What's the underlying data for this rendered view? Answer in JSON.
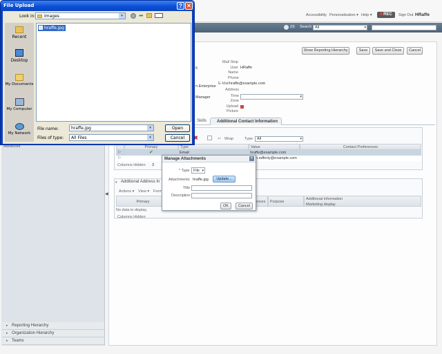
{
  "app": {
    "header_links": [
      "Accessibility",
      "Personalization ▾",
      "Help ▾"
    ],
    "brand": "REC",
    "sign_out": "Sign Out",
    "user": "HRaffe",
    "notif_count": "(0)",
    "search_label": "Search",
    "search_scope": "All"
  },
  "toolbar": {
    "show_hierarchy": "Show Reporting Hierarchy",
    "save": "Save",
    "save_close": "Save and Close",
    "cancel": "Cancel"
  },
  "profile": {
    "fields_left": [
      "6",
      "n Enterprise",
      "Manager"
    ],
    "mail_stop": "Mail Stop",
    "user_name_label": "User Name",
    "user_name_value": "HRaffe",
    "phone": "Phone",
    "email_label": "E-Mail",
    "email_value": "hraffe@example.com",
    "address": "Address",
    "time_zone": "Time Zone",
    "upload_picture": "Upload Picture"
  },
  "tabs": {
    "skills": "Skills",
    "additional_contact": "Additional Contact Information"
  },
  "contact_grid": {
    "wrap": "Wrap",
    "type_label": "Type",
    "type_value": "All",
    "columns": [
      "Primary",
      "Type",
      "Value",
      "Contact Preferences"
    ],
    "rows": [
      {
        "type": "Email",
        "value": "hraffe@example.com"
      },
      {
        "type": "",
        "value": "h.rafferty@example.com"
      }
    ],
    "columns_hidden_label": "Columns Hidden",
    "columns_hidden_value": "3"
  },
  "address_section": {
    "title": "Additional Address In",
    "actions": "Actions ▾",
    "view": "View ▾",
    "format": "Form",
    "columns": [
      "Primary",
      "ences",
      "Purpose",
      "Additional Information"
    ],
    "subcolumn": "Marketing display",
    "no_data": "No data to display.",
    "columns_hidden_label": "Columns Hidden"
  },
  "left_panel": {
    "advanced": "Advanced",
    "bottom_items": [
      "Reporting Hierarchy",
      "Organization Hierarchy",
      "Teams"
    ]
  },
  "manage_attachments": {
    "title": "Manage Attachments",
    "type_label": "* Type",
    "type_value": "File",
    "attachments_label": "Attachments",
    "file_name": "hraffe.jpg",
    "update_button": "Update...",
    "title_label": "Title",
    "description_label": "Description",
    "ok": "OK",
    "cancel": "Cancel"
  },
  "file_dialog": {
    "title": "File Upload",
    "look_in_label": "Look in:",
    "look_in_value": "Images",
    "places": [
      "Recent",
      "Desktop",
      "My Documents",
      "My Computer",
      "My Network"
    ],
    "files": [
      "hraffe.jpg"
    ],
    "file_name_label": "File name:",
    "file_name_value": "hraffe.jpg",
    "file_type_label": "Files of type:",
    "file_type_value": "All Files",
    "open": "Open",
    "cancel": "Cancel"
  }
}
